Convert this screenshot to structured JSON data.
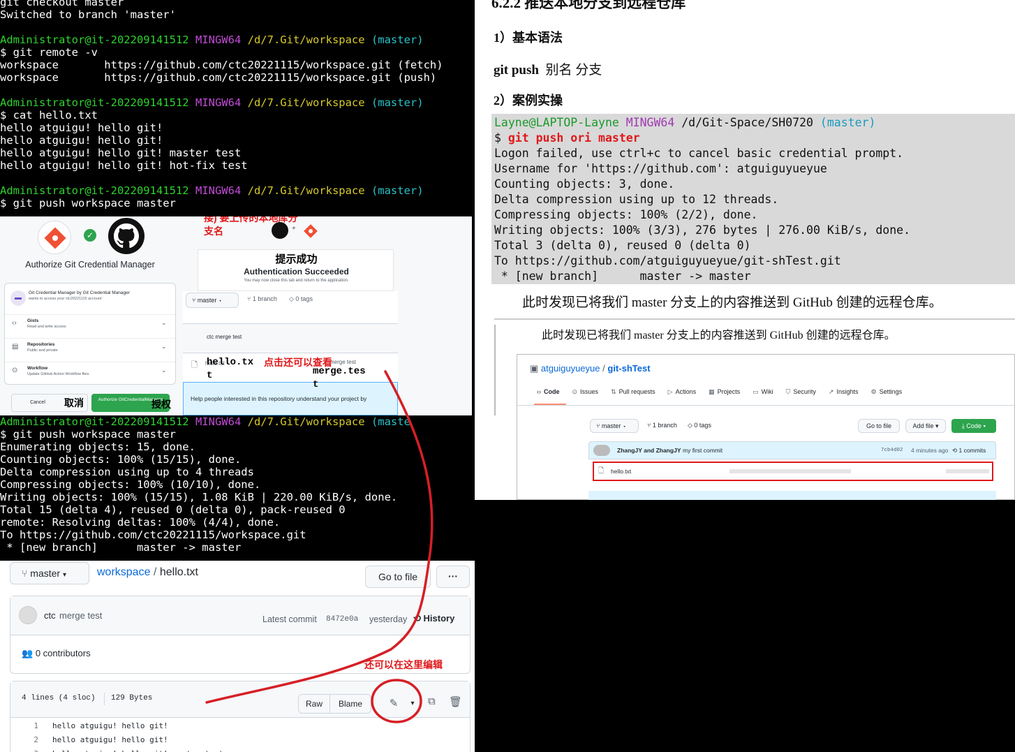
{
  "terminal_top": {
    "lines": [
      [
        [
          "git checkout master",
          ""
        ]
      ],
      [
        [
          "Switched to branch 'master'",
          ""
        ]
      ],
      [
        [
          "",
          ""
        ]
      ],
      [
        [
          "Administrator@it-202209141512 ",
          "g"
        ],
        [
          "MINGW64 ",
          "m"
        ],
        [
          "/d/7.Git/workspace ",
          "y"
        ],
        [
          "(master)",
          "c"
        ]
      ],
      [
        [
          "$ git remote -v",
          ""
        ]
      ],
      [
        [
          "workspace       https://github.com/ctc20221115/workspace.git (fetch)",
          ""
        ]
      ],
      [
        [
          "workspace       https://github.com/ctc20221115/workspace.git (push)",
          ""
        ]
      ],
      [
        [
          "",
          ""
        ]
      ],
      [
        [
          "Administrator@it-202209141512 ",
          "g"
        ],
        [
          "MINGW64 ",
          "m"
        ],
        [
          "/d/7.Git/workspace ",
          "y"
        ],
        [
          "(master)",
          "c"
        ]
      ],
      [
        [
          "$ cat hello.txt",
          ""
        ]
      ],
      [
        [
          "hello atguigu! hello git!",
          ""
        ]
      ],
      [
        [
          "hello atguigu! hello git!",
          ""
        ]
      ],
      [
        [
          "hello atguigu! hello git! master test",
          ""
        ]
      ],
      [
        [
          "hello atguigu! hello git! hot-fix test",
          ""
        ]
      ],
      [
        [
          "",
          ""
        ]
      ],
      [
        [
          "Administrator@it-202209141512 ",
          "g"
        ],
        [
          "MINGW64 ",
          "m"
        ],
        [
          "/d/7.Git/workspace ",
          "y"
        ],
        [
          "(master)",
          "c"
        ]
      ],
      [
        [
          "$ git push workspace master",
          ""
        ]
      ]
    ]
  },
  "annotations": {
    "alias_note": "git push 别名(或者链接) 要上传的本地库分支名",
    "success_note": "提示成功",
    "view_note": "点击还可以查看",
    "cancel_note": "取消",
    "authorize_note": "授权",
    "edit_note": "还可以在这里编辑",
    "hello_file": "hello.txt",
    "merge_file": "merge.test"
  },
  "gcm": {
    "title": "Authorize Git Credential Manager",
    "app_line": "Git Credential Manager by Git Credential Manager",
    "app_sub": "wants to access your ctc20221115 account",
    "perms": [
      {
        "title": "Gists",
        "desc": "Read and write access",
        "icon": "code-icon"
      },
      {
        "title": "Repositories",
        "desc": "Public and private",
        "icon": "repo-icon"
      },
      {
        "title": "Workflow",
        "desc": "Update GitHub Action Workflow files.",
        "icon": "workflow-icon"
      }
    ],
    "cancel": "Cancel",
    "authorize": "Authorize GitCredentialManager"
  },
  "auth": {
    "title": "Authentication Succeeded",
    "sub": "You may now close this tab and return to the application."
  },
  "repo_mini": {
    "branch": "master",
    "branches": "1 branch",
    "tags": "0 tags",
    "commit": "ctc merge test",
    "file1": "hello.txt",
    "file2": "merge test",
    "readme": "Help people interested in this repository understand your project by"
  },
  "terminal_bottom": {
    "lines": [
      [
        [
          "Administrator@it-202209141512 ",
          "g"
        ],
        [
          "MINGW64 ",
          "m"
        ],
        [
          "/d/7.Git/workspace ",
          "y"
        ],
        [
          "(maste",
          "c"
        ]
      ],
      [
        [
          "$ git push workspace master",
          ""
        ]
      ],
      [
        [
          "Enumerating objects: 15, done.",
          ""
        ]
      ],
      [
        [
          "Counting objects: 100% (15/15), done.",
          ""
        ]
      ],
      [
        [
          "Delta compression using up to 4 threads",
          ""
        ]
      ],
      [
        [
          "Compressing objects: 100% (10/10), done.",
          ""
        ]
      ],
      [
        [
          "Writing objects: 100% (15/15), 1.08 KiB | 220.00 KiB/s, done.",
          ""
        ]
      ],
      [
        [
          "Total 15 (delta 4), reused 0 (delta 0), pack-reused 0",
          ""
        ]
      ],
      [
        [
          "remote: Resolving deltas: 100% (4/4), done.",
          ""
        ]
      ],
      [
        [
          "To https://github.com/ctc20221115/workspace.git",
          ""
        ]
      ],
      [
        [
          " * [new branch]      master -> master",
          ""
        ]
      ]
    ]
  },
  "file_view": {
    "branch": "master",
    "repo": "workspace",
    "sep": "/",
    "file": "hello.txt",
    "goto": "Go to file",
    "more": "···",
    "commit_author": "ctc",
    "commit_msg": "merge test",
    "latest": "Latest commit",
    "sha": "8472e0a",
    "when": "yesterday",
    "history": "History",
    "contributors": "0 contributors",
    "lines_info": "4 lines (4 sloc)",
    "size": "129 Bytes",
    "raw": "Raw",
    "blame": "Blame",
    "code": [
      {
        "n": "1",
        "t": "hello atguigu! hello git!"
      },
      {
        "n": "2",
        "t": "hello atguigu! hello git!"
      },
      {
        "n": "3",
        "t": "hello atguigu! hello git! master test"
      }
    ]
  },
  "doc": {
    "heading": "6.2.2 推送本地分支到远程仓库",
    "s1": "1）基本语法",
    "syntax_cmd": "git push",
    "syntax_rest": "别名  分支",
    "s2": "2）案例实操",
    "term_lines": [
      [
        [
          "Layne@LAPTOP-Layne ",
          "g"
        ],
        [
          "MINGW64 ",
          "m"
        ],
        [
          "/d/Git-Space/SH0720 ",
          ""
        ],
        [
          "(master)",
          "c"
        ]
      ],
      [
        [
          "$ ",
          ""
        ],
        [
          "git push ori master",
          "r"
        ]
      ],
      [
        [
          "Logon failed, use ctrl+c to cancel basic credential prompt.",
          ""
        ]
      ],
      [
        [
          "Username for 'https://github.com': atguiguyueyue",
          ""
        ]
      ],
      [
        [
          "Counting objects: 3, done.",
          ""
        ]
      ],
      [
        [
          "Delta compression using up to 12 threads.",
          ""
        ]
      ],
      [
        [
          "Compressing objects: 100% (2/2), done.",
          ""
        ]
      ],
      [
        [
          "Writing objects: 100% (3/3), 276 bytes | 276.00 KiB/s, done.",
          ""
        ]
      ],
      [
        [
          "Total 3 (delta 0), reused 0 (delta 0)",
          ""
        ]
      ],
      [
        [
          "To https://github.com/atguiguyueyue/git-shTest.git",
          ""
        ]
      ],
      [
        [
          " * [new branch]      master -> master",
          ""
        ]
      ]
    ],
    "para": "此时发现已将我们 master 分支上的内容推送到 GitHub 创建的远程仓库。",
    "para2": "此时发现已将我们 master 分支上的内容推送到 GitHub 创建的远程仓库。"
  },
  "doc_repo": {
    "owner": "atguiguyueyue",
    "name": "git-shTest",
    "tabs": [
      "Code",
      "Issues",
      "Pull requests",
      "Actions",
      "Projects",
      "Wiki",
      "Security",
      "Insights",
      "Settings"
    ],
    "branch": "master",
    "branches": "1 branch",
    "tags": "0 tags",
    "goto": "Go to file",
    "add": "Add file",
    "code": "Code",
    "commit_authors": "ZhangJY and ZhangJY",
    "commit_msg": "my first commit",
    "sha": "7cb4d02",
    "when": "4 minutes ago",
    "commits": "1 commits",
    "file": "hello.txt"
  }
}
